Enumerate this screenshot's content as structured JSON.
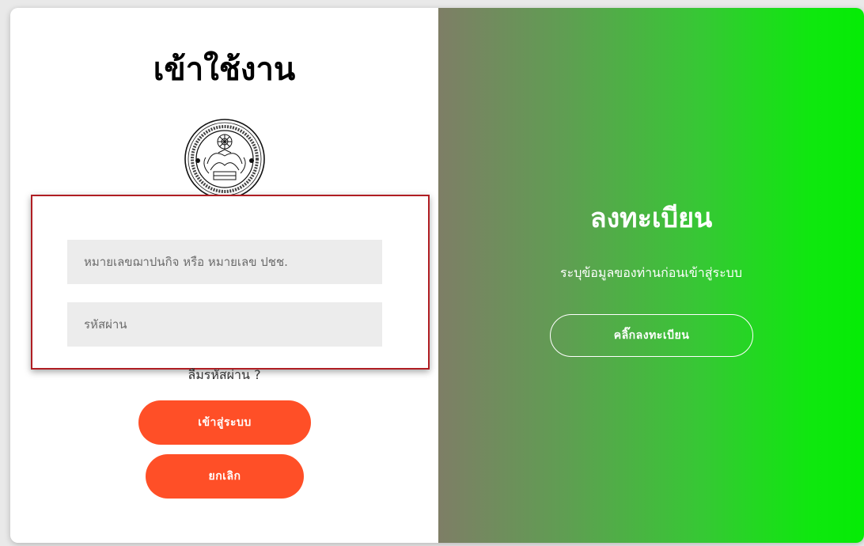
{
  "login": {
    "title": "เข้าใช้งาน",
    "username_placeholder": "หมายเลขฌาปนกิจ หรือ หมายเลข ปชช.",
    "username_value": "",
    "password_placeholder": "รหัสผ่าน",
    "password_value": "",
    "forgot_label": "ลืมรหัสผ่าน ?",
    "submit_label": "เข้าสู่ระบบ",
    "cancel_label": "ยกเลิก",
    "seal_icon": "association-seal-icon"
  },
  "register": {
    "title": "ลงทะเบียน",
    "description": "ระบุข้อมูลของท่านก่อนเข้าสู่ระบบ",
    "button_label": "คลิ๊กลงทะเบียน"
  },
  "colors": {
    "primary_button": "#ff4f27",
    "form_highlight_border": "#b01e23",
    "gradient_start": "#7e7e66",
    "gradient_end": "#05ec05",
    "input_background": "#ececec"
  }
}
